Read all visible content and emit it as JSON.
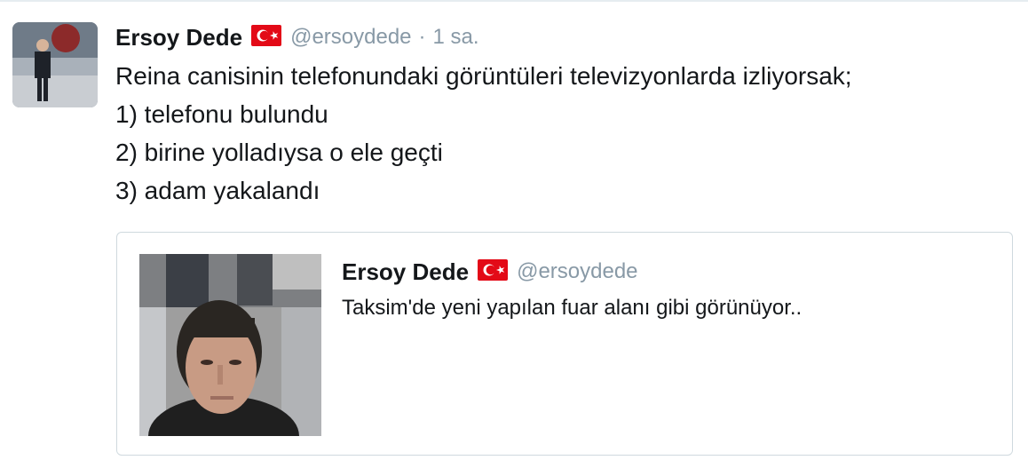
{
  "tweet": {
    "author_name": "Ersoy Dede",
    "flag_icon": "turkey-flag-icon",
    "handle": "@ersoydede",
    "separator": "·",
    "timestamp": "1 sa.",
    "lines": [
      "Reina canisinin telefonundaki görüntüleri televizyonlarda izliyorsak;",
      "1) telefonu bulundu",
      "2) birine yolladıysa o ele geçti",
      "3) adam yakalandı"
    ]
  },
  "quoted_tweet": {
    "author_name": "Ersoy Dede",
    "flag_icon": "turkey-flag-icon",
    "handle": "@ersoydede",
    "text": "Taksim'de yeni yapılan fuar alanı gibi görünüyor.."
  },
  "colors": {
    "text": "#14171a",
    "muted": "#8899a6",
    "border": "#cfd9de",
    "flag_red": "#e30a17"
  }
}
